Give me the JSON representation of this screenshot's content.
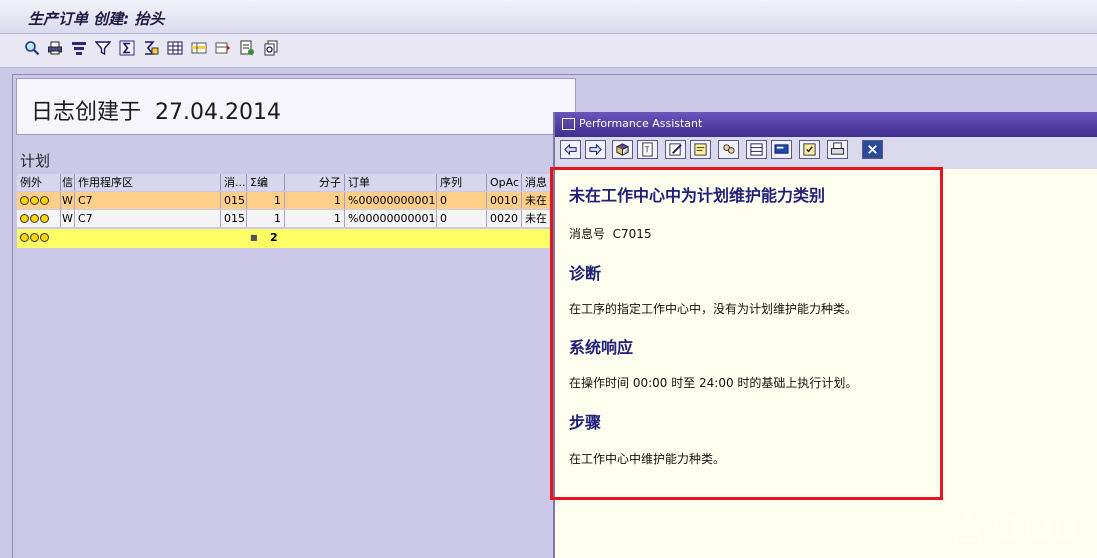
{
  "window": {
    "title": "生产订单 创建: 抬头"
  },
  "toolbar": {
    "icons": [
      "find-icon",
      "print-icon",
      "sort-icon",
      "filter-icon",
      "sum-icon",
      "subtotal-icon",
      "layout-icon",
      "select-layout-icon",
      "change-layout-icon",
      "export-icon",
      "details-icon"
    ]
  },
  "log": {
    "created_label": "日志创建于",
    "created_date": "27.04.2014"
  },
  "plan": {
    "label": "计划"
  },
  "table": {
    "headers": [
      "例外",
      "信",
      "作用程序区",
      "消...",
      "Σ编",
      "分子",
      "订单",
      "序列",
      "OpAc",
      "消息"
    ],
    "rows": [
      {
        "area": "W",
        "program": "C7",
        "msg": "015",
        "count": "1",
        "numerator": "1",
        "order": "%00000000001",
        "seq": "0",
        "opac": "0010",
        "text": "未在"
      },
      {
        "area": "W",
        "program": "C7",
        "msg": "015",
        "count": "1",
        "numerator": "1",
        "order": "%00000000001",
        "seq": "0",
        "opac": "0020",
        "text": "未在"
      }
    ],
    "total": {
      "marker": "■",
      "count": "2"
    }
  },
  "assistant": {
    "title": "Performance Assistant",
    "heading": "未在工作中心中为计划维护能力类别",
    "msg_label": "消息号",
    "msg_no": "C7015",
    "diag_heading": "诊断",
    "diag_text": "在工序的指定工作中心中，没有为计划维护能力种类。",
    "response_heading": "系统响应",
    "response_text": "在操作时间  00:00 时至  24:00 时的基础上执行计划。",
    "steps_heading": "步骤",
    "steps_text": "在工作中心中维护能力种类。",
    "grip": "....",
    "tools": [
      "back-icon",
      "forward-icon",
      "book-icon",
      "technical-info-icon",
      "edit-icon",
      "note-icon",
      "group-icon",
      "table-icon",
      "display-icon",
      "settings-icon",
      "print-icon",
      "close-icon"
    ]
  },
  "colors": {
    "highlight": "#e8141b",
    "accent": "#3e2f8e",
    "warning_row": "#ffcf8a",
    "total_row": "#ffff66"
  }
}
